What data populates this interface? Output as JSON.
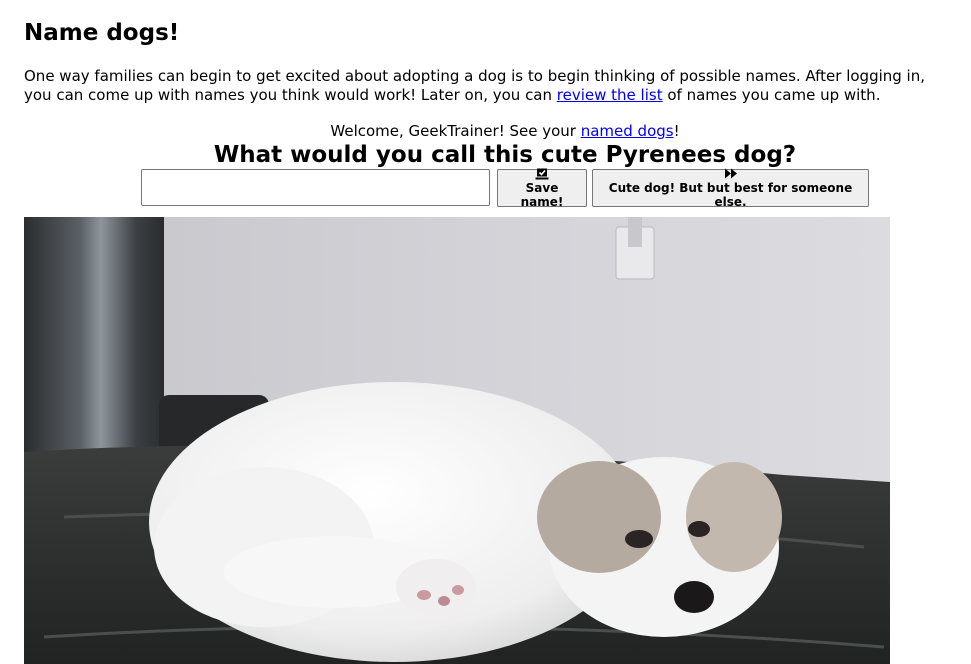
{
  "page": {
    "title": "Name dogs!",
    "intro_before_link": "One way families can begin to get excited about adopting a dog is to begin thinking of possible names. After logging in,",
    "intro_line2_before_link": "you can come up with names you think would work! Later on, you can ",
    "intro_link": "review the list",
    "intro_after_link": " of names you came up with."
  },
  "welcome": {
    "prefix": "Welcome, GeekTrainer! See your ",
    "link": "named dogs",
    "suffix": "!"
  },
  "question": "What would you call this cute Pyrenees dog?",
  "form": {
    "name_value": "",
    "save_icon": "save-icon",
    "save_label": "Save name!",
    "skip_icon": "fast-forward-icon",
    "skip_label": "Cute dog! But but best for someone else."
  },
  "photo": {
    "subject": "white Great Pyrenees puppy lying on a dark leather ottoman"
  }
}
